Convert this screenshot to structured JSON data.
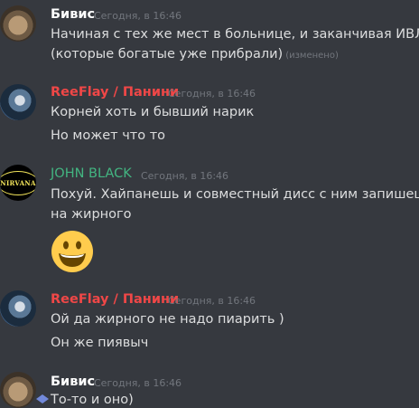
{
  "messages": [
    {
      "author": "Бивис",
      "author_color": "#ffffff",
      "timestamp": "Сегодня, в 16:46",
      "lines": [
        "Начиная с тех же мест в больнице, и заканчивая ИВЛ",
        "(которые богатые уже прибрали)"
      ],
      "edited": "(изменено)"
    },
    {
      "author": "ReeFlay / Панини",
      "author_color": "#f04747",
      "timestamp": "Сегодня, в 16:46",
      "lines": [
        "Корней хоть и бывший нарик",
        "Но может что то"
      ]
    },
    {
      "author": "JOHN BLACK",
      "author_color": "#43b581",
      "timestamp": "Сегодня, в 16:46",
      "lines": [
        "Похуй. Хайпанешь и совместный дисс с ним запишешь",
        "на жирного"
      ],
      "avatar_text": "NIRVANA",
      "emoji": "grinning-face"
    },
    {
      "author": "ReeFlay / Панини",
      "author_color": "#f04747",
      "timestamp": "Сегодня, в 16:46",
      "lines": [
        "Ой да жирного не надо пиарить )",
        "Он же пиявыч"
      ]
    },
    {
      "author": "Бивис",
      "author_color": "#ffffff",
      "timestamp": "Сегодня, в 16:46",
      "lines": [
        "То-то и оно)"
      ]
    }
  ]
}
